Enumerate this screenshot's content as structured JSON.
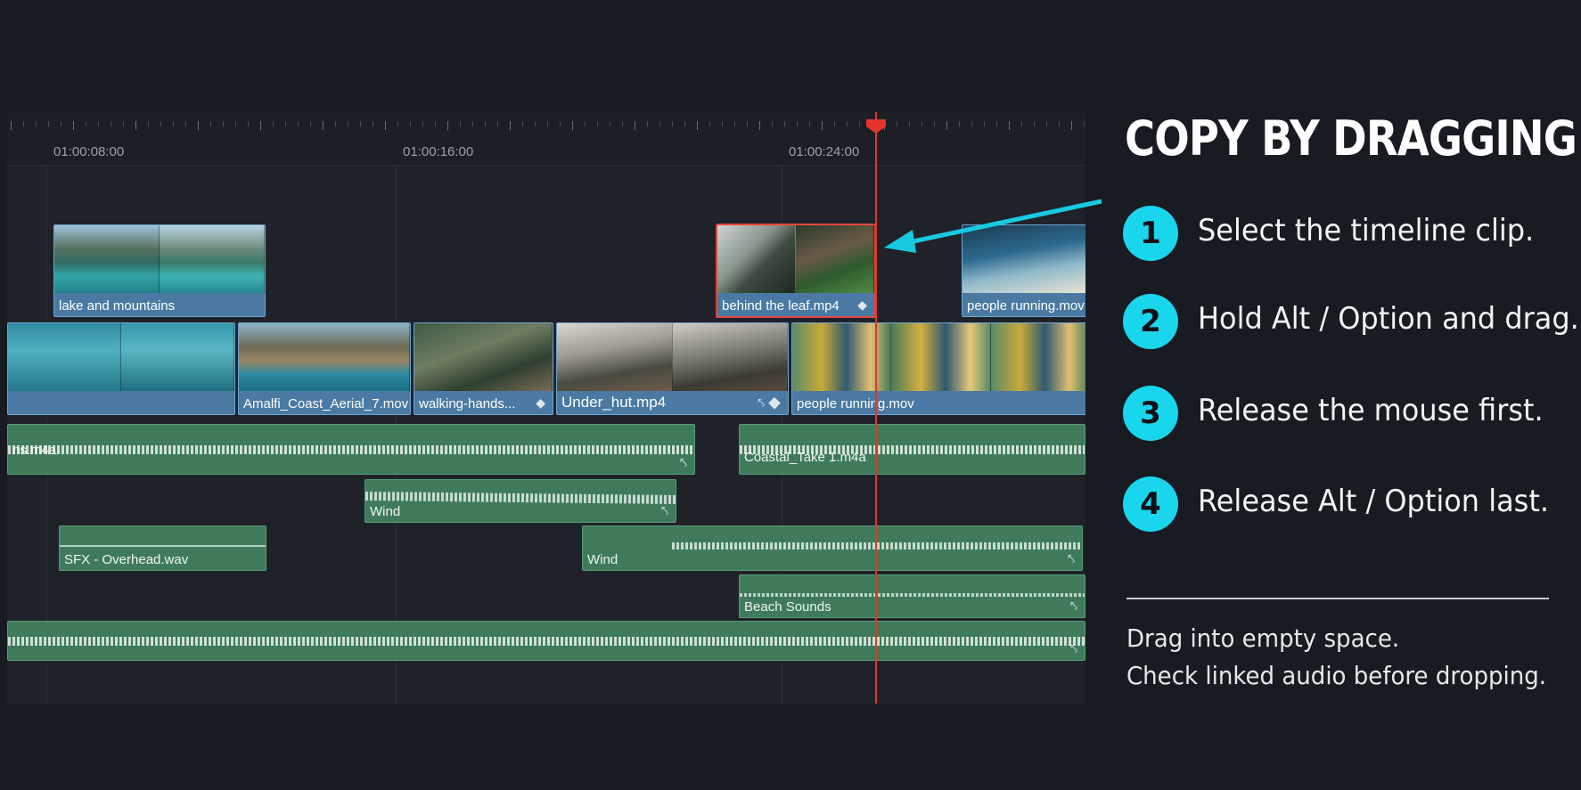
{
  "timeline": {
    "timecodes": [
      "01:00:08:00",
      "01:00:16:00",
      "01:00:24:00"
    ],
    "video_clips": [
      {
        "label": "lake and mountains"
      },
      {
        "label": "behind the leaf.mp4",
        "selected": true
      },
      {
        "label": "people running.mov"
      },
      {
        "label": ""
      },
      {
        "label": "Amalfi_Coast_Aerial_7.mov"
      },
      {
        "label": "walking-hands..."
      },
      {
        "label": "Under_hut.mp4"
      },
      {
        "label": "people running.mov"
      }
    ],
    "audio_clips": [
      {
        "label": "ns.m4a"
      },
      {
        "label": "Coastal_Take 1.m4a"
      },
      {
        "label": "Wind"
      },
      {
        "label": "SFX - Overhead.wav"
      },
      {
        "label": "Wind"
      },
      {
        "label": "Beach Sounds"
      },
      {
        "label": ""
      }
    ],
    "colors": {
      "video": "#4a7aa3",
      "audio": "#3f7b5b",
      "playhead": "#e5352b",
      "selection": "#e2473d"
    }
  },
  "instructions": {
    "title": "COPY BY DRAGGING",
    "steps": [
      {
        "number": "1",
        "text": "Select the timeline clip."
      },
      {
        "number": "2",
        "text": "Hold Alt / Option and drag."
      },
      {
        "number": "3",
        "text": "Release the mouse first."
      },
      {
        "number": "4",
        "text": "Release  Alt / Option last."
      }
    ],
    "notes": [
      "Drag into empty space.",
      "Check linked audio before dropping."
    ],
    "accent": "#19d6ec"
  }
}
